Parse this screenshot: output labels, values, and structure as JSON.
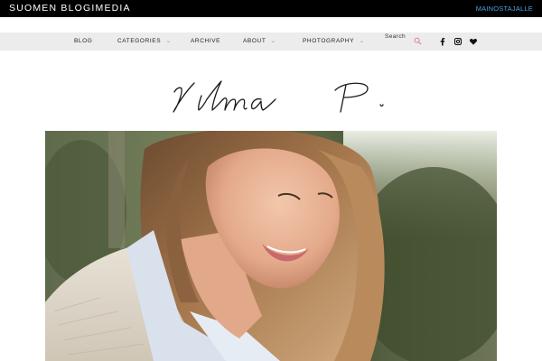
{
  "topbar": {
    "brand": "SUOMEN BLOGIMEDIA",
    "advertisers_link": "MAINOSTAJALLE"
  },
  "nav": {
    "items": [
      {
        "label": "BLOG",
        "has_dropdown": false
      },
      {
        "label": "CATEGORIES",
        "has_dropdown": true
      },
      {
        "label": "ARCHIVE",
        "has_dropdown": false
      },
      {
        "label": "ABOUT",
        "has_dropdown": true
      },
      {
        "label": "PHOTOGRAPHY",
        "has_dropdown": true
      }
    ],
    "dropdown_glyph": "⌄",
    "search_placeholder": "Search",
    "social_icons": [
      "facebook-icon",
      "instagram-icon",
      "heart-icon"
    ]
  },
  "logo": {
    "text": "Vilma P."
  },
  "colors": {
    "topbar_bg": "#000000",
    "nav_bg": "#ececec",
    "accent_pink": "#e57b94",
    "link_blue": "#4aa3df"
  }
}
